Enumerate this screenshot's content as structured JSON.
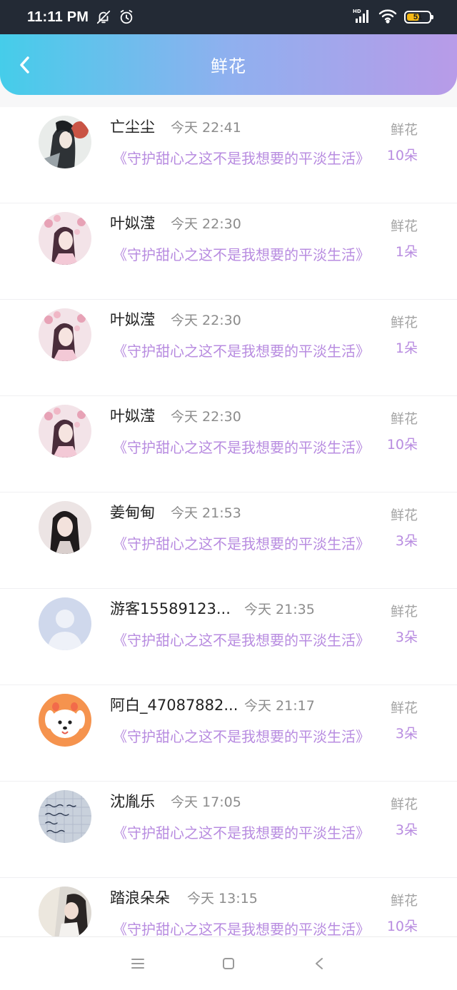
{
  "status_bar": {
    "time": "11:11 PM",
    "battery": "51",
    "icons": [
      "bell-off-icon",
      "alarm-icon",
      "hd-signal-icon",
      "wifi-icon",
      "battery-icon"
    ]
  },
  "header": {
    "title": "鲜花",
    "back_icon": "chevron-left-icon",
    "gradient": [
      "#45cdea",
      "#b89be8"
    ]
  },
  "colors": {
    "accent": "#b88ce0",
    "name": "#222222",
    "muted": "#8c8c8c"
  },
  "records": [
    {
      "name": "亡尘尘",
      "time": "今天 22:41",
      "book": "《守护甜心之这不是我想要的平淡生活》",
      "gift": "鲜花",
      "count": "10朵",
      "avatar": "avatar-ink-portrait"
    },
    {
      "name": "叶姒滢",
      "time": "今天 22:30",
      "book": "《守护甜心之这不是我想要的平淡生活》",
      "gift": "鲜花",
      "count": "1朵",
      "avatar": "avatar-blossom-girl"
    },
    {
      "name": "叶姒滢",
      "time": "今天 22:30",
      "book": "《守护甜心之这不是我想要的平淡生活》",
      "gift": "鲜花",
      "count": "1朵",
      "avatar": "avatar-blossom-girl"
    },
    {
      "name": "叶姒滢",
      "time": "今天 22:30",
      "book": "《守护甜心之这不是我想要的平淡生活》",
      "gift": "鲜花",
      "count": "10朵",
      "avatar": "avatar-blossom-girl"
    },
    {
      "name": "姜甸甸",
      "time": "今天 21:53",
      "book": "《守护甜心之这不是我想要的平淡生活》",
      "gift": "鲜花",
      "count": "3朵",
      "avatar": "avatar-longhair-girl"
    },
    {
      "name": "游客15589123...",
      "time": "今天 21:35",
      "book": "《守护甜心之这不是我想要的平淡生活》",
      "gift": "鲜花",
      "count": "3朵",
      "avatar": "avatar-default"
    },
    {
      "name": "阿白_47087882...",
      "time": "今天 21:17",
      "book": "《守护甜心之这不是我想要的平淡生活》",
      "gift": "鲜花",
      "count": "3朵",
      "avatar": "avatar-cartoon-dog"
    },
    {
      "name": "沈胤乐",
      "time": "今天 17:05",
      "book": "《守护甜心之这不是我想要的平淡生活》",
      "gift": "鲜花",
      "count": "3朵",
      "avatar": "avatar-handwriting"
    },
    {
      "name": "踏浪朵朵",
      "time": "今天 13:15",
      "book": "《守护甜心之这不是我想要的平淡生活》",
      "gift": "鲜花",
      "count": "10朵",
      "avatar": "avatar-photo-girl"
    }
  ],
  "nav_bar": {
    "icons": [
      "menu-icon",
      "home-square-icon",
      "back-triangle-icon"
    ]
  }
}
